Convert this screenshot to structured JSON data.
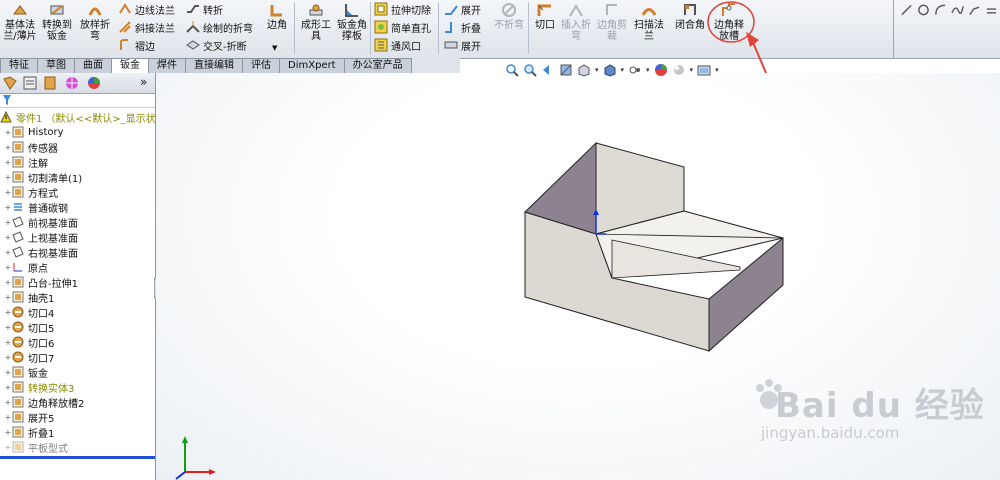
{
  "ribbon": {
    "base_flange": "基体法\n兰/薄片",
    "convert_to_sheetmetal": "转换到\n钣金",
    "lofted_bend": "放样折\n弯",
    "edge_flange": "边线法兰",
    "miter_flange": "斜接法兰",
    "hem": "褶边",
    "jog": "转折",
    "sketched_bend": "绘制的折弯",
    "cross_break": "交叉-折断",
    "corner": "边角",
    "forming_tool": "成形工\n具",
    "gusset": "钣金角\n撑板",
    "extruded_cut": "拉伸切除",
    "simple_hole": "简单直孔",
    "vent": "通风口",
    "unfold": "展开",
    "fold": "折叠",
    "flatten": "展开",
    "no_bends": "不折弯",
    "rip": "切口",
    "insert_bends": "插入折\n弯",
    "corner_trim": "边角剪\n裁",
    "swept_flange": "扫描法\n兰",
    "closed_corner": "闭合角",
    "corner_relief": "边角释\n放槽"
  },
  "tabs": [
    "特征",
    "草图",
    "曲面",
    "钣金",
    "焊件",
    "直接编辑",
    "评估",
    "DimXpert",
    "办公室产品"
  ],
  "active_tab": "钣金",
  "tree": {
    "part": "零件1 （默认<<默认>_显示状",
    "items": [
      "History",
      "传感器",
      "注解",
      "切割清单(1)",
      "方程式",
      "普通碳钢",
      "前视基准面",
      "上视基准面",
      "右视基准面",
      "原点",
      "凸台-拉伸1",
      "抽壳1",
      "切口4",
      "切口5",
      "切口6",
      "切口7",
      "钣金",
      "转换实体3",
      "边角释放槽2",
      "展开5",
      "折叠1",
      "平板型式"
    ]
  },
  "watermark": {
    "logo": "Bai du 经验",
    "url": "jingyan.baidu.com"
  },
  "colors": {
    "highlight_circle": "#e0463c",
    "tree_warning": "#8a8a00",
    "part_face_light": "#dcd8d2",
    "part_face_dark": "#8d8290",
    "axis_x": "#e02020",
    "axis_y": "#10a010",
    "axis_z": "#1030e0"
  }
}
